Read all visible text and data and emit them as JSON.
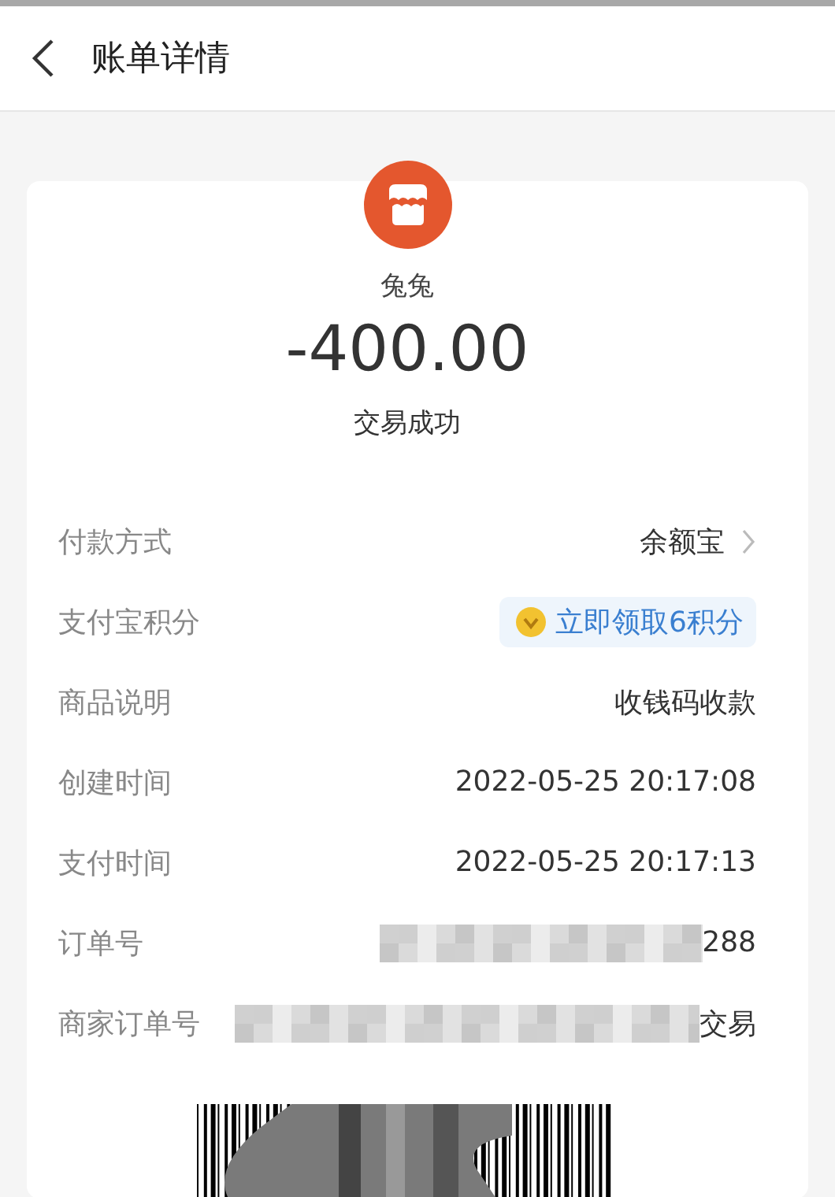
{
  "header": {
    "title": "账单详情"
  },
  "merchant": {
    "name": "兔兔",
    "amount": "-400.00",
    "status": "交易成功"
  },
  "rows": [
    {
      "kind": "link",
      "label": "付款方式",
      "value": "余额宝"
    },
    {
      "kind": "points",
      "label": "支付宝积分",
      "value": "立即领取6积分"
    },
    {
      "kind": "text",
      "label": "商品说明",
      "value": "收钱码收款"
    },
    {
      "kind": "text",
      "label": "创建时间",
      "value": "2022-05-25 20:17:08"
    },
    {
      "kind": "text",
      "label": "支付时间",
      "value": "2022-05-25 20:17:13"
    },
    {
      "kind": "redacted",
      "label": "订单号",
      "value": "288"
    },
    {
      "kind": "redacted",
      "label": "商家订单号",
      "value": "交易"
    }
  ]
}
